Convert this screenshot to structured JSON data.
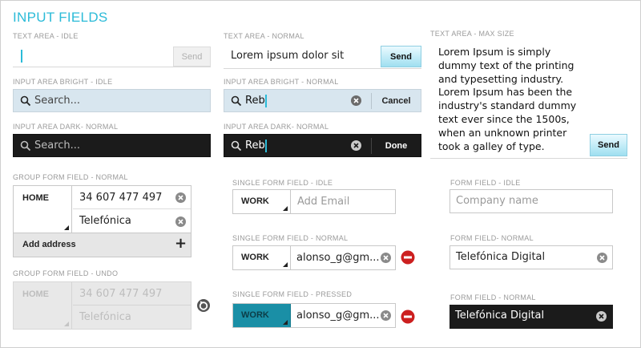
{
  "title": "INPUT FIELDS",
  "col1": {
    "textarea_idle": {
      "label": "TEXT AREA - IDLE",
      "send": "Send"
    },
    "bright_idle": {
      "label": "INPUT AREA BRIGHT - IDLE",
      "placeholder": "Search..."
    },
    "dark_normal": {
      "label": "INPUT AREA DARK- NORMAL",
      "placeholder": "Search..."
    },
    "group_normal": {
      "label": "GROUP FORM FIELD - NORMAL",
      "type": "HOME",
      "phone": "34 607 477 497",
      "carrier": "Telefónica",
      "add": "Add address",
      "plus": "+"
    },
    "group_undo": {
      "label": "GROUP FORM FIELD - UNDO",
      "type": "HOME",
      "phone": "34 607 477 497",
      "carrier": "Telefónica"
    }
  },
  "col2": {
    "textarea_normal": {
      "label": "TEXT AREA - NORMAL",
      "value": "Lorem ipsum dolor sit",
      "send": "Send"
    },
    "bright_normal": {
      "label": "INPUT AREA BRIGHT - NORMAL",
      "value": "Reb",
      "action": "Cancel"
    },
    "dark_normal": {
      "label": "INPUT AREA DARK- NORMAL",
      "value": "Reb",
      "action": "Done"
    },
    "single_idle": {
      "label": "SINGLE FORM FIELD - IDLE",
      "type": "WORK",
      "placeholder": "Add Email"
    },
    "single_normal": {
      "label": "SINGLE FORM FIELD - NORMAL",
      "type": "WORK",
      "value": "alonso_g@gm..."
    },
    "single_pressed": {
      "label": "SINGLE FORM FIELD - PRESSED",
      "type": "WORK",
      "value": "alonso_g@gm..."
    }
  },
  "col3": {
    "textarea_max": {
      "label": "TEXT AREA - MAX SIZE",
      "value": "Lorem Ipsum is simply dummy text of the printing and typesetting industry. Lorem Ipsum has been the industry's standard dummy text ever since the 1500s, when an unknown printer took a galley of type.",
      "send": "Send"
    },
    "form_idle": {
      "label": "FORM FIELD - IDLE",
      "placeholder": "Company name"
    },
    "form_normal": {
      "label": "FORM FIELD- NORMAL",
      "value": "Telefónica Digital"
    },
    "form_normal_dark": {
      "label": "FORM FIELD - NORMAL",
      "value": "Telefónica Digital"
    }
  },
  "colors": {
    "accent": "#2bbbd8",
    "pressed": "#1a8fa6",
    "danger": "#cc1f1f",
    "dark": "#1b1b1b",
    "bright": "#d8e6ef"
  },
  "icons": [
    "search-icon",
    "clear-icon",
    "minus-circle-icon",
    "undo-icon",
    "plus-icon",
    "dropdown-triangle-icon"
  ]
}
